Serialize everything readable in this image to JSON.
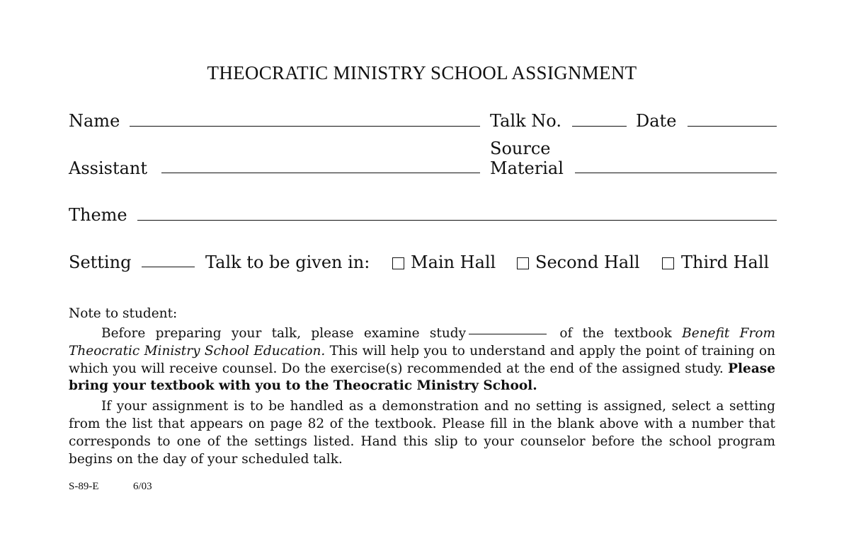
{
  "form": {
    "title": "THEOCRATIC MINISTRY SCHOOL ASSIGNMENT",
    "fields": {
      "name_label": "Name",
      "talk_no_label": "Talk No.",
      "date_label": "Date",
      "assistant_label": "Assistant",
      "source_label_line1": "Source",
      "source_label_line2": "Material",
      "theme_label": "Theme",
      "setting_label": "Setting",
      "talk_given_in_label": "Talk to be given in:"
    },
    "hall_options": [
      {
        "label": "Main Hall",
        "checked": false
      },
      {
        "label": "Second Hall",
        "checked": false
      },
      {
        "label": "Third Hall",
        "checked": false
      }
    ]
  },
  "note": {
    "heading": "Note to student:",
    "paragraph1": {
      "before_blank": "Before preparing your talk, please examine study",
      "after_blank": " of the textbook ",
      "book_title": "Benefit From Theocratic Ministry School Education.",
      "middle": " This will help you to understand and apply the point of training on which you will receive counsel. Do the exercise(s) recommended at the end of the assigned study. ",
      "bold": "Please bring your textbook with you to the Theocratic Ministry School."
    },
    "paragraph2": "If your assignment is to be handled as a demonstration and no setting is assigned, select a setting from the list that appears on page 82 of the textbook. Please fill in the blank above with a number that corresponds to one of the settings listed. Hand this slip to your counselor before the school program begins on the day of your scheduled talk."
  },
  "footer": {
    "form_code": "S-89-E",
    "revision": "6/03"
  }
}
